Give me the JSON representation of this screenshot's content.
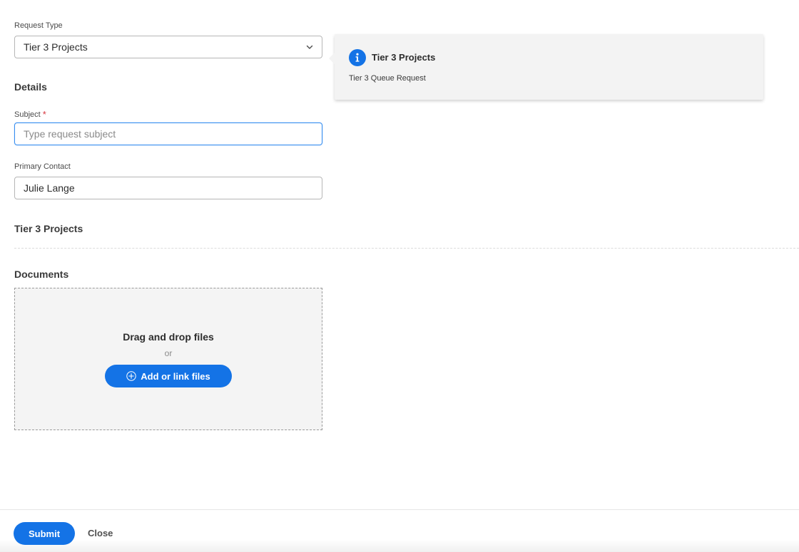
{
  "form": {
    "request_type_label": "Request Type",
    "request_type_value": "Tier 3 Projects",
    "details_title": "Details",
    "subject_label": "Subject",
    "subject_required_mark": "*",
    "subject_placeholder": "Type request subject",
    "primary_contact_label": "Primary Contact",
    "primary_contact_value": "Julie Lange",
    "section_title": "Tier 3 Projects",
    "documents_title": "Documents"
  },
  "info_card": {
    "icon": "info-icon",
    "title": "Tier 3 Projects",
    "description": "Tier 3 Queue Request",
    "accent_color": "#1473e6"
  },
  "dropzone": {
    "title": "Drag and drop files",
    "or_text": "or",
    "button_label": "Add or link files",
    "button_icon": "plus-circle-icon"
  },
  "footer": {
    "submit_label": "Submit",
    "close_label": "Close"
  }
}
